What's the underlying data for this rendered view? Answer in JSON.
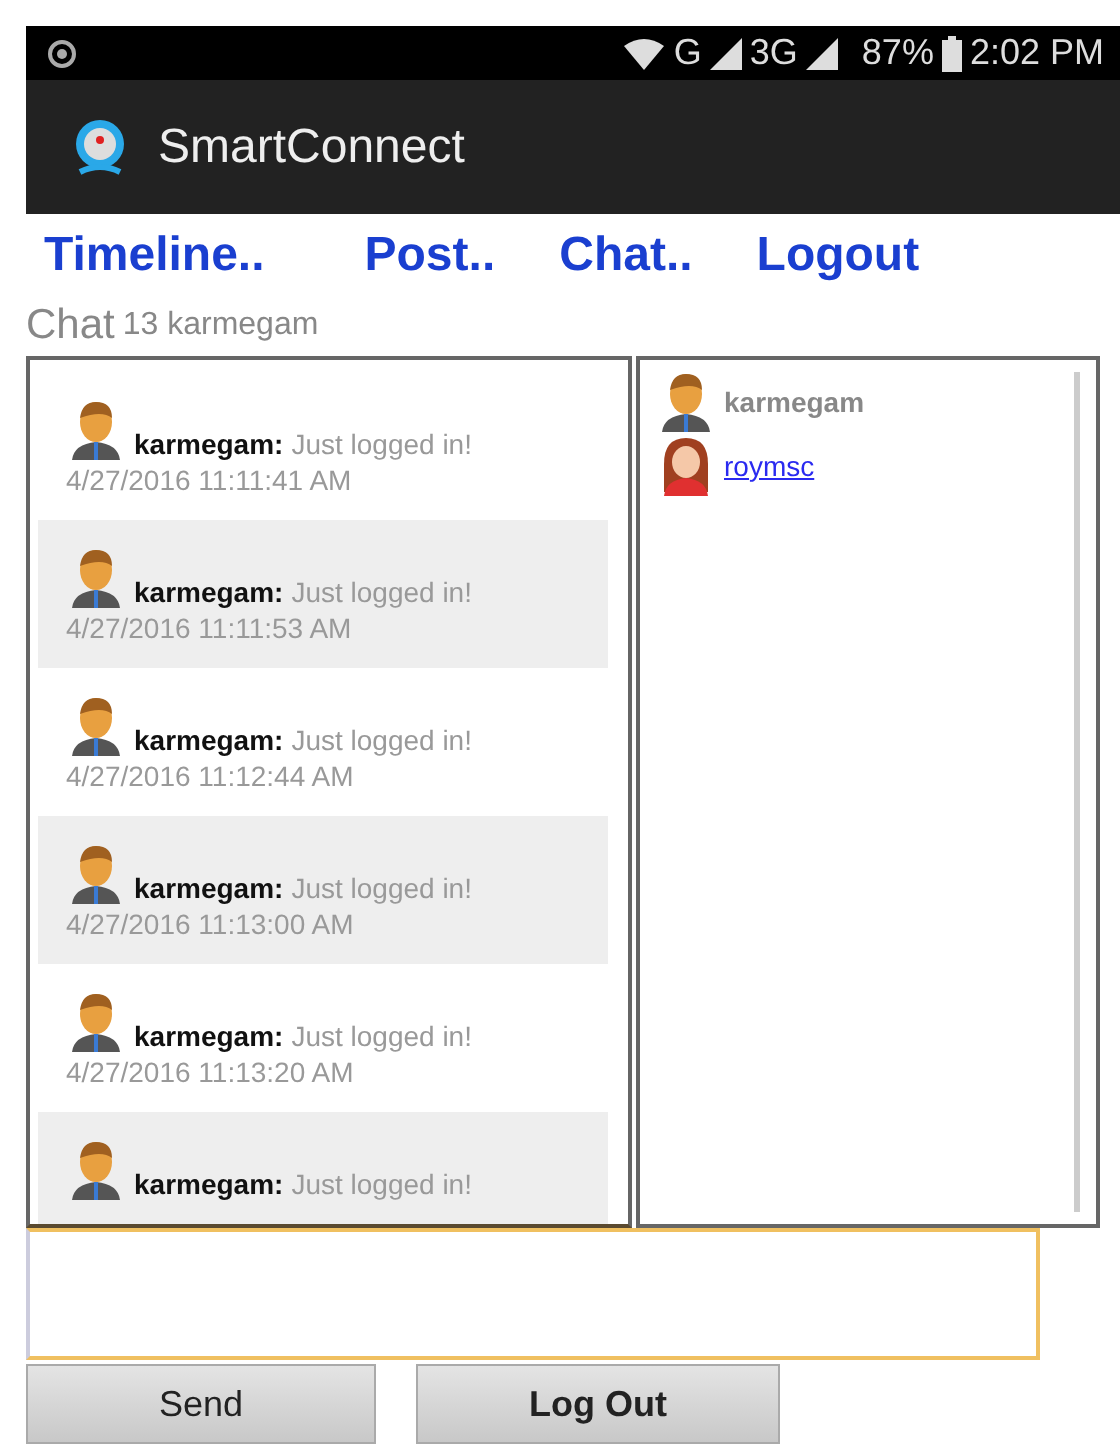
{
  "status_bar": {
    "network": "G",
    "network_2": "3G",
    "battery": "87%",
    "time": "2:02 PM"
  },
  "app_bar": {
    "title": "SmartConnect"
  },
  "nav": [
    {
      "label": "Timeline.."
    },
    {
      "label": "Post.."
    },
    {
      "label": "Chat.."
    },
    {
      "label": "Logout"
    }
  ],
  "header": {
    "title": "Chat",
    "subtitle": "13 karmegam"
  },
  "messages": [
    {
      "user": "karmegam:",
      "text": "Just logged in!",
      "time": "4/27/2016 11:11:41 AM"
    },
    {
      "user": "karmegam:",
      "text": "Just logged in!",
      "time": "4/27/2016 11:11:53 AM"
    },
    {
      "user": "karmegam:",
      "text": "Just logged in!",
      "time": "4/27/2016 11:12:44 AM"
    },
    {
      "user": "karmegam:",
      "text": "Just logged in!",
      "time": "4/27/2016 11:13:00 AM"
    },
    {
      "user": "karmegam:",
      "text": "Just logged in!",
      "time": "4/27/2016 11:13:20 AM"
    },
    {
      "user": "karmegam:",
      "text": "Just logged in!"
    }
  ],
  "users": [
    {
      "name": "karmegam",
      "kind": "male",
      "link": false
    },
    {
      "name": "roymsc",
      "kind": "female",
      "link": true
    }
  ],
  "buttons": [
    {
      "label": "Send",
      "kind": "normal"
    },
    {
      "label": "Log Out",
      "kind": "bold"
    }
  ]
}
